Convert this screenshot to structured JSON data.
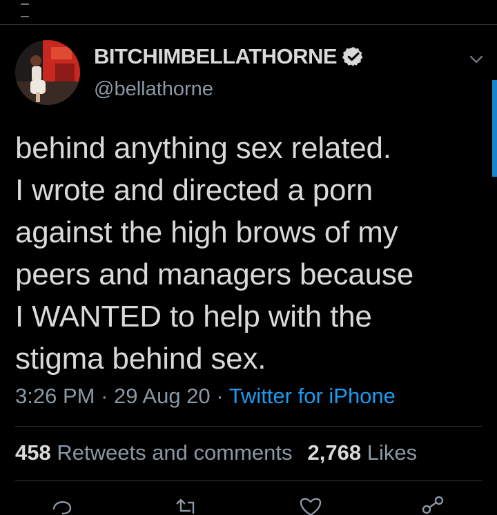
{
  "tweet": {
    "display_name": "BITCHIMBELLATHORNE",
    "handle": "@bellathorne",
    "verified": true,
    "text_lines": [
      "behind anything sex related.",
      "I wrote and directed a porn",
      "against the high brows of my",
      "peers and managers because",
      "I WANTED to help with the",
      "stigma behind sex."
    ],
    "time": "3:26 PM",
    "date": "29 Aug 20",
    "source": "Twitter for iPhone",
    "separator": "·"
  },
  "stats": {
    "retweets_count": "458",
    "retweets_label": "Retweets and comments",
    "likes_count": "2,768",
    "likes_label": "Likes"
  },
  "actions": [
    "reply-icon",
    "retweet-icon",
    "like-icon",
    "share-icon"
  ],
  "colors": {
    "background": "#000000",
    "text": "#d9d9d9",
    "secondary": "#8b98a5",
    "accent": "#1d9bf0",
    "divider": "#2f3336"
  }
}
